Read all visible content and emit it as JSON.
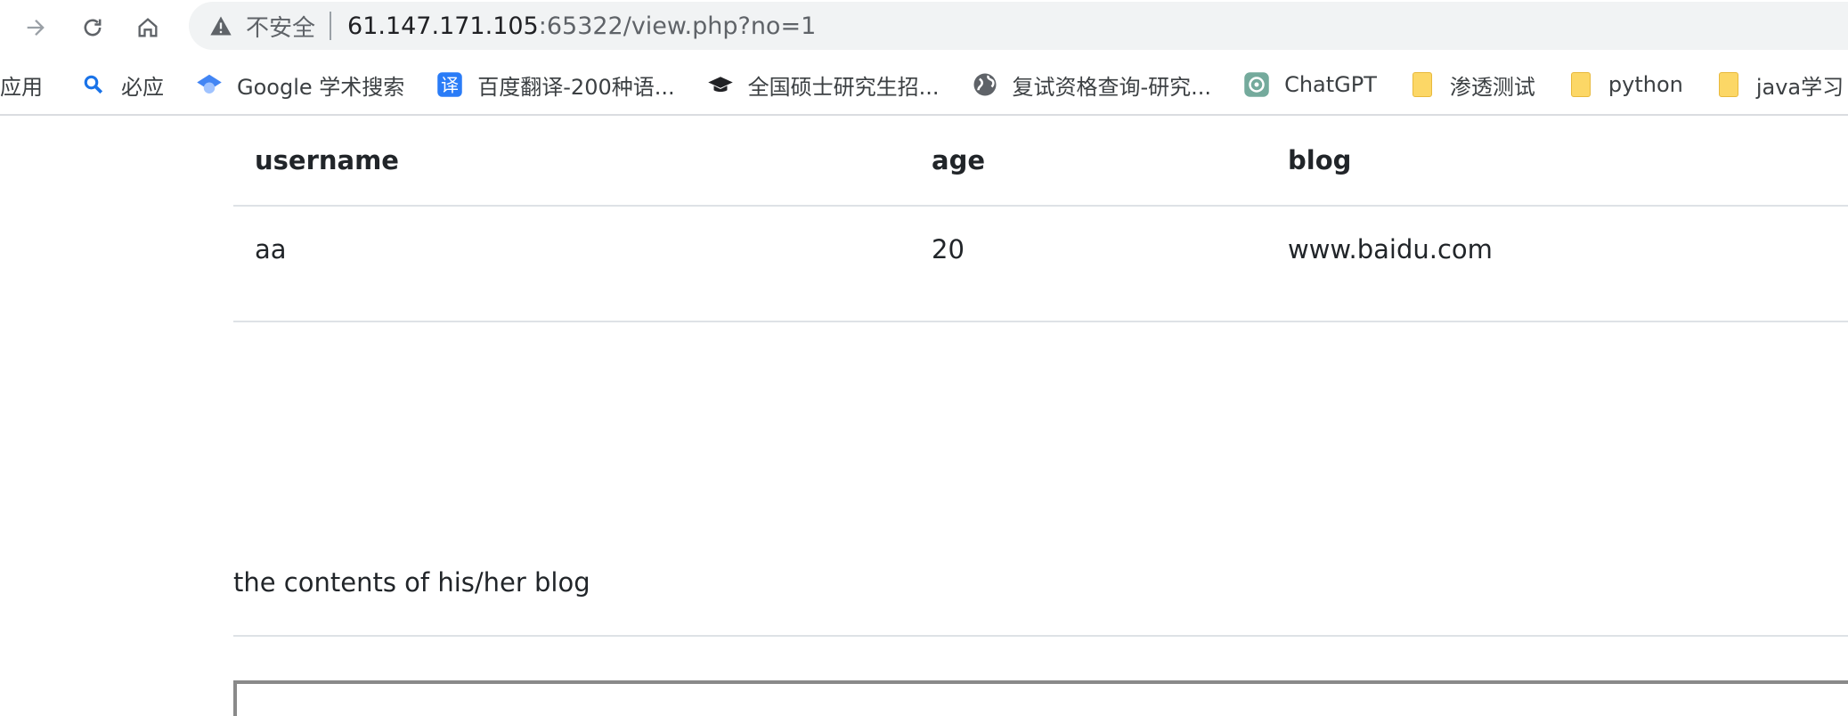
{
  "browser": {
    "security_label": "不安全",
    "url_host": "61.147.171.105",
    "url_rest": ":65322/view.php?no=1"
  },
  "bookmarks": [
    {
      "label": "应用",
      "icon": "apps-icon"
    },
    {
      "label": "必应",
      "icon": "bing-search-icon"
    },
    {
      "label": "Google 学术搜索",
      "icon": "google-scholar-icon"
    },
    {
      "label": "百度翻译-200种语...",
      "icon": "baidu-translate-icon"
    },
    {
      "label": "全国硕士研究生招...",
      "icon": "graduation-cap-icon"
    },
    {
      "label": "复试资格查询-研究...",
      "icon": "globe-icon"
    },
    {
      "label": "ChatGPT",
      "icon": "chatgpt-icon"
    },
    {
      "label": "渗透测试",
      "icon": "folder-icon"
    },
    {
      "label": "python",
      "icon": "folder-icon"
    },
    {
      "label": "java学习",
      "icon": "folder-icon"
    }
  ],
  "table": {
    "headers": [
      "username",
      "age",
      "blog"
    ],
    "rows": [
      [
        "aa",
        "20",
        "www.baidu.com"
      ]
    ]
  },
  "blog_contents": "the contents of his/her blog",
  "colors": {
    "omnibox_bg": "#f1f3f4",
    "folder": "#fcd766",
    "divider": "#dee2e6"
  }
}
